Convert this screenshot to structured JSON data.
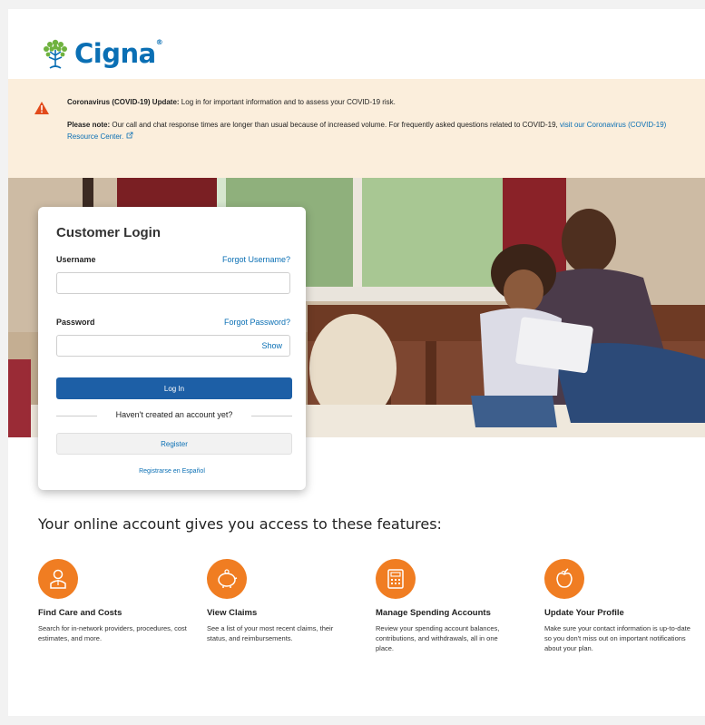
{
  "brand": {
    "name": "Cigna",
    "accent": "#0a6fb4",
    "orange": "#f07d22"
  },
  "alert": {
    "line1_bold": "Coronavirus (COVID-19) Update:",
    "line1_text": " Log in for important information and to assess your COVID-19 risk.",
    "line2_bold": "Please note:",
    "line2_text": " Our call and chat response times are longer than usual because of increased volume. For frequently asked questions related to COVID-19, ",
    "line2_link": "visit our Coronavirus (COVID-19) Resource Center."
  },
  "login": {
    "title": "Customer Login",
    "username_label": "Username",
    "forgot_username": "Forgot Username?",
    "username_value": "",
    "password_label": "Password",
    "forgot_password": "Forgot Password?",
    "password_value": "",
    "show_label": "Show",
    "login_button": "Log In",
    "no_account": "Haven't created an account yet?",
    "register_button": "Register",
    "espanol_link": "Registrarse en Español"
  },
  "features": {
    "title": "Your online account gives you access to these features:",
    "items": [
      {
        "icon": "doctor-icon",
        "title": "Find Care and Costs",
        "desc": "Search for in-network providers, procedures, cost estimates, and more."
      },
      {
        "icon": "piggy-bank-icon",
        "title": "View Claims",
        "desc": "See a list of your most recent claims, their status, and reimbursements."
      },
      {
        "icon": "calculator-icon",
        "title": "Manage Spending Accounts",
        "desc": "Review your spending account balances, contributions, and withdrawals, all in one place."
      },
      {
        "icon": "apple-icon",
        "title": "Update Your Profile",
        "desc": "Make sure your contact information is up-to-date so you don't miss out on important notifications about your plan."
      }
    ]
  }
}
